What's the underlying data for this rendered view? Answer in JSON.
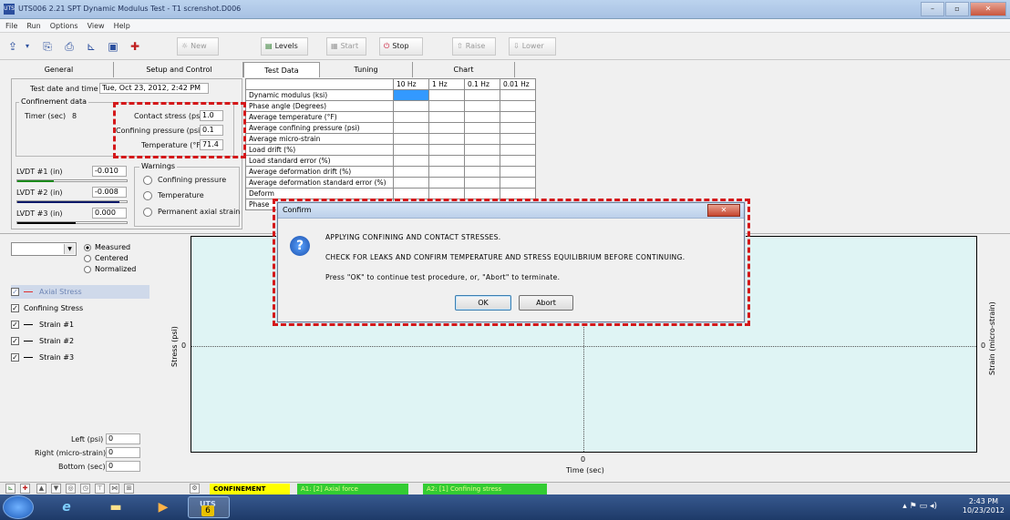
{
  "window": {
    "title": "UTS006 2.21 SPT Dynamic Modulus Test - T1 screnshot.D006",
    "controls": [
      "–",
      "▫",
      "✕"
    ]
  },
  "menu": [
    "File",
    "Run",
    "Options",
    "View",
    "Help"
  ],
  "toolbar": {
    "new_label": "New",
    "levels_label": "Levels",
    "start_label": "Start",
    "stop_label": "Stop",
    "raise_label": "Raise",
    "lower_label": "Lower"
  },
  "tabs": [
    "General",
    "Setup and Control",
    "Test Data",
    "Tuning",
    "Chart"
  ],
  "info": {
    "test_date_label": "Test date and time",
    "test_date_value": "Tue, Oct 23, 2012, 2:42 PM",
    "confinement_group": "Confinement data",
    "timer_label": "Timer (sec)",
    "timer_value": "8",
    "contact_stress_label": "Contact stress (psi)",
    "contact_stress_value": "1.0",
    "confining_pressure_label": "Confining pressure (psi)",
    "confining_pressure_value": "0.1",
    "temperature_label": "Temperature (°F)",
    "temperature_value": "71.4",
    "lvdt1_label": "LVDT #1 (in)",
    "lvdt1_value": "-0.010",
    "lvdt2_label": "LVDT #2 (in)",
    "lvdt2_value": "-0.008",
    "lvdt3_label": "LVDT #3 (in)",
    "lvdt3_value": "0.000",
    "warnings_group": "Warnings",
    "warn_confining": "Confining pressure",
    "warn_temperature": "Temperature",
    "warn_axial": "Permanent axial strain"
  },
  "test_table": {
    "freq_headers": [
      "10 Hz",
      "1 Hz",
      "0.1 Hz",
      "0.01 Hz"
    ],
    "rows": [
      "Dynamic modulus (ksi)",
      "Phase angle (Degrees)",
      "Average temperature  (°F)",
      "Average confining pressure  (psi)",
      "Average micro-strain",
      "Load drift (%)",
      "Load standard error (%)",
      "Average deformation drift (%)",
      "Average deformation standard error (%)",
      "Deform",
      "Phase"
    ]
  },
  "chart_controls": {
    "mode_measured": "Measured",
    "mode_centered": "Centered",
    "mode_normalized": "Normalized",
    "series": [
      "Axial Stress",
      "Confining Stress",
      "Strain #1",
      "Strain #2",
      "Strain #3"
    ],
    "left_label": "Left (psi)",
    "left_value": "0",
    "right_label": "Right (micro-strain)",
    "right_value": "0",
    "bottom_label": "Bottom (sec)",
    "bottom_value": "0"
  },
  "chart_data": {
    "type": "line",
    "ylabel": "Stress (psi)",
    "y2label": "Strain (micro-strain)",
    "xlabel": "Time (sec)",
    "y_tick": "0",
    "y2_tick": "0",
    "x_tick": "0",
    "background": "#dff4f4"
  },
  "status": {
    "mode": "CONFINEMENT",
    "a1": "A1: [2] Axial force",
    "a2": "A2: [1] Confining stress"
  },
  "dialog": {
    "title": "Confirm",
    "close": "✕",
    "line1": "APPLYING CONFINING AND CONTACT STRESSES.",
    "line2": "CHECK FOR LEAKS AND CONFIRM TEMPERATURE AND STRESS EQUILIBRIUM BEFORE CONTINUING.",
    "line3": "Press \"OK\" to continue test procedure, or, \"Abort\" to terminate.",
    "ok": "OK",
    "abort": "Abort"
  },
  "taskbar": {
    "uts_label": "UTS",
    "uts_badge": "6",
    "time": "2:43 PM",
    "date": "10/23/2012"
  },
  "colors": {
    "highlight": "#d4181a",
    "plot_bg": "#dff4f4",
    "status_yellow": "#ffff00",
    "status_green": "#33cc33"
  }
}
